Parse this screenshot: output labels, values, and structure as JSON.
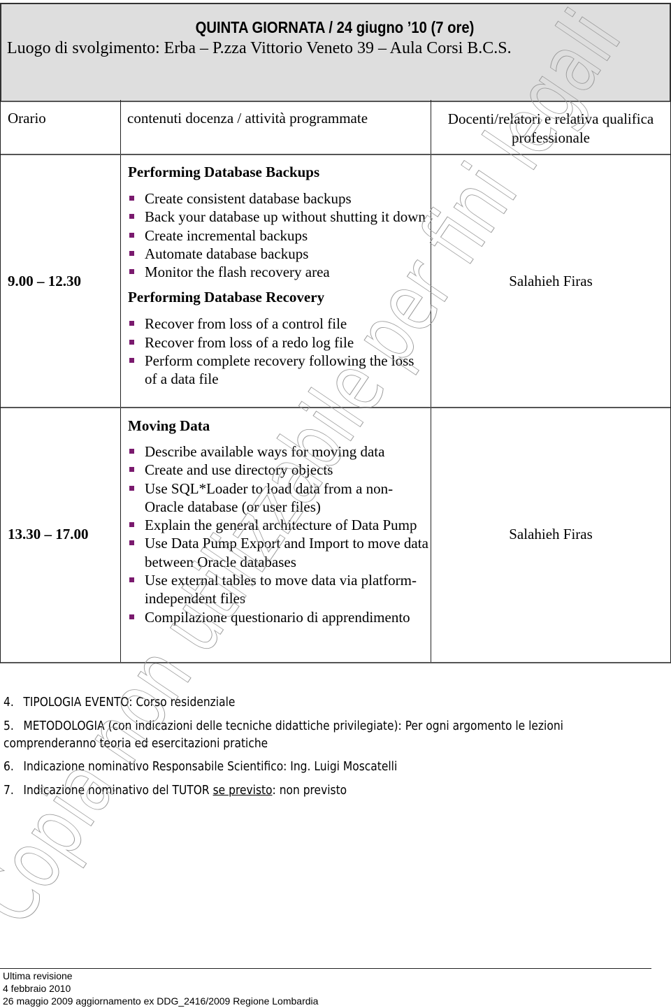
{
  "header": {
    "title": "QUINTA GIORNATA / 24 giugno ’10 (7 ore)",
    "location": "Luogo di svolgimento: Erba – P.zza Vittorio Veneto 39 – Aula Corsi B.C.S."
  },
  "table": {
    "columns": [
      "Orario",
      "contenuti docenza / attività programmate",
      "Docenti/relatori e relativa qualifica professionale"
    ],
    "rows": [
      {
        "time": "9.00 – 12.30",
        "teacher": "Salahieh Firas",
        "sections": [
          {
            "title": "Performing Database Backups",
            "items": [
              "Create consistent database backups",
              "Back your database up without shutting it down",
              "Create incremental backups",
              "Automate database backups",
              "Monitor the flash recovery area"
            ]
          },
          {
            "title": "Performing Database Recovery",
            "items": [
              "Recover from loss of a control file",
              "Recover from loss of a redo log file",
              "Perform complete recovery following the loss of a data file"
            ]
          }
        ]
      },
      {
        "time": "13.30 – 17.00",
        "teacher": "Salahieh Firas",
        "sections": [
          {
            "title": "Moving Data",
            "items": [
              "Describe available ways for moving data",
              "Create and use directory objects",
              "Use SQL*Loader to load data from a non-Oracle database (or user files)",
              "Explain the general architecture of Data Pump",
              "Use Data Pump Export and Import to move data between Oracle databases",
              "Use external tables to move data via platform-independent files",
              "Compilazione questionario di apprendimento"
            ]
          }
        ]
      }
    ]
  },
  "info": [
    {
      "num": "4.",
      "text": "TIPOLOGIA EVENTO: Corso residenziale"
    },
    {
      "num": "5.",
      "text": "METODOLOGIA (con indicazioni delle tecniche didattiche privilegiate): Per ogni argomento le lezioni",
      "cont": "comprenderanno teoria ed esercitazioni pratiche"
    },
    {
      "num": "6.",
      "text": "Indicazione nominativo Responsabile Scientifico: Ing. Luigi Moscatelli"
    },
    {
      "num": "7.",
      "pre": "Indicazione nominativo del TUTOR ",
      "underlined": "se previsto",
      "post": ": non previsto"
    }
  ],
  "footer": {
    "line1": "Ultima revisione",
    "line2": "4 febbraio 2010",
    "line3": "26 maggio 2009 aggiornamento ex DDG_2416/2009 Regione Lombardia"
  },
  "watermark": {
    "text": "Copia non utilizzabile per fini legali"
  },
  "colors": {
    "header_bg": "#dedede",
    "bullet": "#7a1a6e"
  }
}
